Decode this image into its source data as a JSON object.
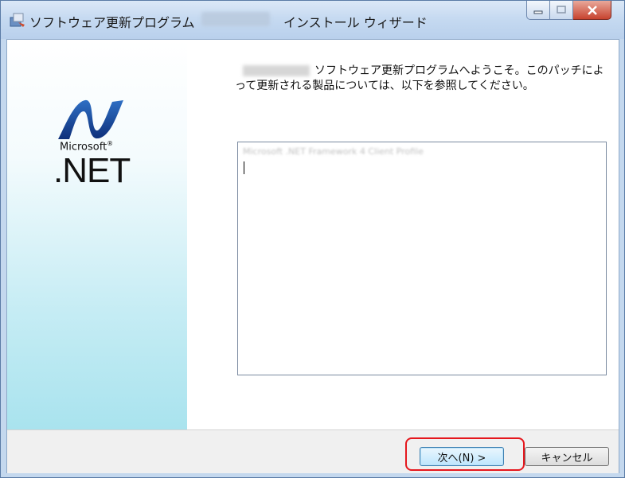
{
  "window": {
    "title_prefix": "ソフトウェア更新プログラム",
    "title_suffix": "インストール ウィザード"
  },
  "sidebar": {
    "brand_microsoft": "Microsoft",
    "brand_registered": "®",
    "brand_net": ".NET"
  },
  "main": {
    "welcome_line1": "ソフトウェア更新プログラムへようこそ。このパッチによ",
    "welcome_line2": "って更新される製品については、以下を参照してください。",
    "products_list": [
      "Microsoft .NET Framework 4 Client Profile"
    ]
  },
  "footer": {
    "next_label": "次へ(N) >",
    "cancel_label": "キャンセル"
  },
  "colors": {
    "highlight": "#e5171d",
    "sidebar_gradient_bottom": "#a9e3ee"
  }
}
